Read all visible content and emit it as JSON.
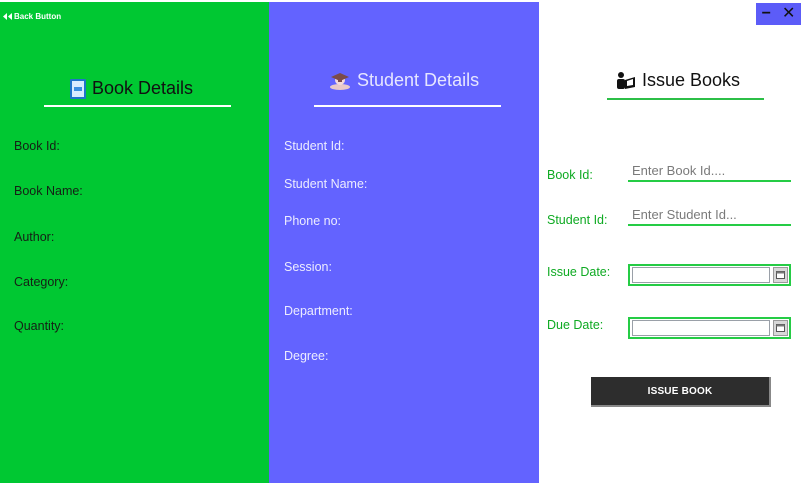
{
  "back_button": {
    "label": "Back Button",
    "icon": "double-left-arrow-icon"
  },
  "window_controls": {
    "minimize": "−",
    "close": "✕"
  },
  "book_details": {
    "title": "Book Details",
    "icon": "book-icon",
    "fields": [
      {
        "label": "Book Id:"
      },
      {
        "label": "Book Name:"
      },
      {
        "label": "Author:"
      },
      {
        "label": "Category:"
      },
      {
        "label": "Quantity:"
      }
    ]
  },
  "student_details": {
    "title": "Student Details",
    "icon": "student-icon",
    "fields": [
      {
        "label": "Student Id:"
      },
      {
        "label": "Student Name:"
      },
      {
        "label": "Phone no:"
      },
      {
        "label": "Session:"
      },
      {
        "label": "Department:"
      },
      {
        "label": "Degree:"
      }
    ]
  },
  "issue_books": {
    "title": "Issue Books",
    "icon": "reader-icon",
    "book_id_label": "Book Id:",
    "book_id_placeholder": "Enter Book Id....",
    "book_id_value": "",
    "student_id_label": "Student Id:",
    "student_id_placeholder": "Enter Student Id...",
    "student_id_value": "",
    "issue_date_label": "Issue Date:",
    "issue_date_value": "",
    "due_date_label": "Due Date:",
    "due_date_value": "",
    "issue_button_label": "ISSUE BOOK"
  },
  "colors": {
    "books_panel": "#00c832",
    "student_panel": "#6363ff",
    "accent_green": "#25cc45",
    "button_dark": "#2d2d2d"
  }
}
